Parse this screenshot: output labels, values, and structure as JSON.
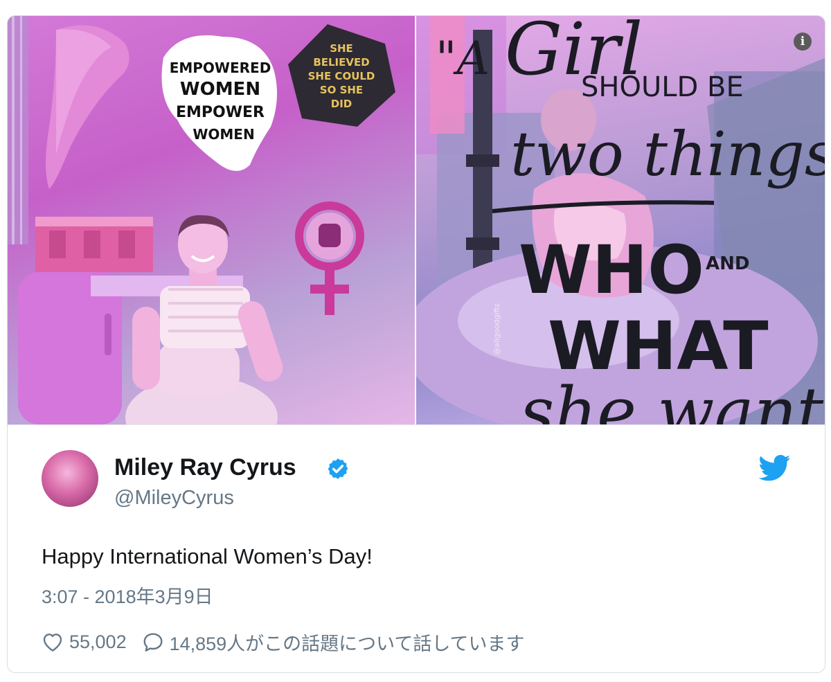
{
  "media": {
    "left_image": {
      "sticker_empowered": [
        "EMPOWERED",
        "WOMEN",
        "EMPOWER",
        "WOMEN"
      ],
      "sticker_believed": [
        "SHE",
        "BELIEVED",
        "SHE COULD",
        "SO SHE",
        "DID"
      ]
    },
    "right_image": {
      "quote_lines": [
        "\"A",
        "Girl",
        "SHOULD BE",
        "two things:",
        "WHO",
        "AND",
        "WHAT",
        "she wants\""
      ],
      "watermark": "@allgoodgifts"
    },
    "info_icon": "info-icon"
  },
  "tweet": {
    "display_name": "Miley Ray Cyrus",
    "handle": "@MileyCyrus",
    "text": "Happy International Women’s Day!",
    "timestamp": "3:07 - 2018年3月9日",
    "like_count": "55,002",
    "reply_text": "14,859人がこの話題について話しています"
  },
  "colors": {
    "verified": "#1da1f2",
    "twitter_brand": "#1da1f2",
    "secondary_text": "#657786",
    "primary_text": "#14171a"
  }
}
